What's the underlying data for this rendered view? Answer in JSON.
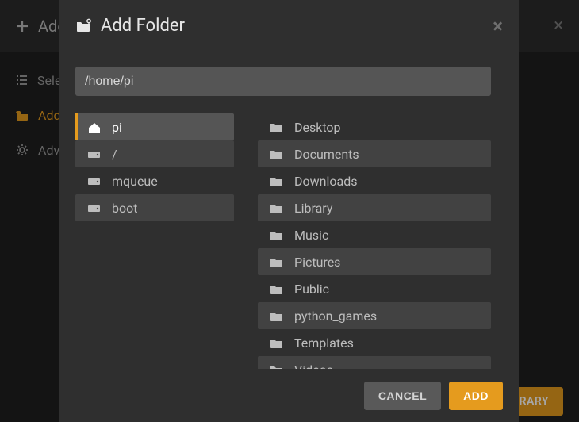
{
  "background": {
    "title": "Add Library",
    "close_glyph": "×",
    "sidebar": {
      "select_label": "Select type",
      "addfolders_label": "Add folders",
      "advanced_label": "Advanced"
    },
    "footer_button": "ADD LIBRARY"
  },
  "modal": {
    "title": "Add Folder",
    "close_glyph": "×",
    "path_value": "/home/pi",
    "left": [
      {
        "label": "pi",
        "icon": "home",
        "active": true,
        "bg": true
      },
      {
        "label": "/",
        "icon": "drive",
        "active": false,
        "bg": true
      },
      {
        "label": "mqueue",
        "icon": "drive",
        "active": false,
        "bg": false
      },
      {
        "label": "boot",
        "icon": "drive",
        "active": false,
        "bg": true
      }
    ],
    "right": [
      {
        "label": "Desktop",
        "bg": false
      },
      {
        "label": "Documents",
        "bg": true
      },
      {
        "label": "Downloads",
        "bg": false
      },
      {
        "label": "Library",
        "bg": true
      },
      {
        "label": "Music",
        "bg": false
      },
      {
        "label": "Pictures",
        "bg": true
      },
      {
        "label": "Public",
        "bg": false
      },
      {
        "label": "python_games",
        "bg": true
      },
      {
        "label": "Templates",
        "bg": false
      },
      {
        "label": "Videos",
        "bg": true
      }
    ],
    "cancel_label": "CANCEL",
    "add_label": "ADD"
  }
}
